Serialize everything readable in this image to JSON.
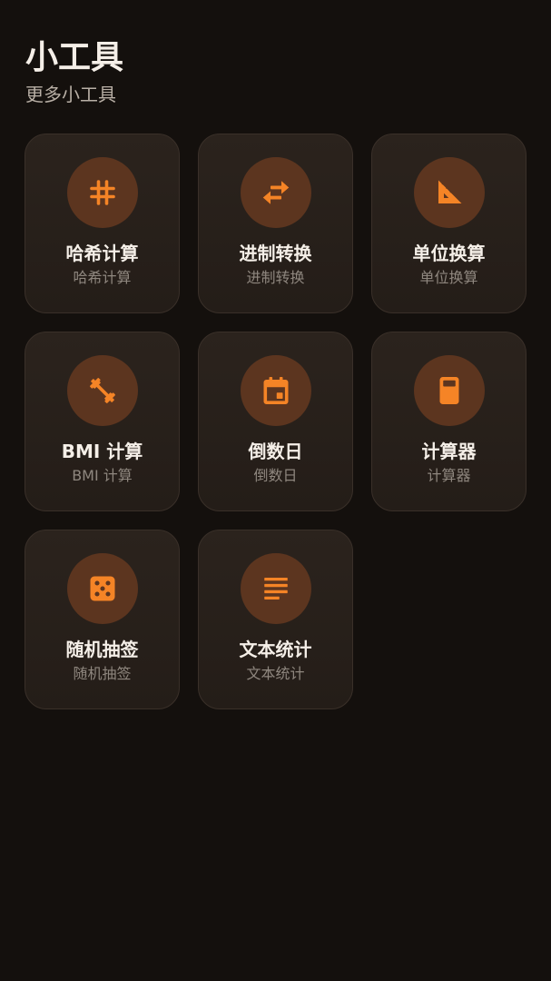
{
  "header": {
    "title": "小工具",
    "subtitle": "更多小工具"
  },
  "accent_color": "#f58426",
  "icon_bg_color": "#5c351f",
  "tools": [
    {
      "title": "哈希计算",
      "subtitle": "哈希计算",
      "icon": "hash-icon"
    },
    {
      "title": "进制转换",
      "subtitle": "进制转换",
      "icon": "swap-arrows-icon"
    },
    {
      "title": "单位换算",
      "subtitle": "单位换算",
      "icon": "set-square-ruler-icon"
    },
    {
      "title": "BMI 计算",
      "subtitle": "BMI 计算",
      "icon": "dumbbell-icon"
    },
    {
      "title": "倒数日",
      "subtitle": "倒数日",
      "icon": "calendar-icon"
    },
    {
      "title": "计算器",
      "subtitle": "计算器",
      "icon": "calculator-icon"
    },
    {
      "title": "随机抽签",
      "subtitle": "随机抽签",
      "icon": "dice-icon"
    },
    {
      "title": "文本统计",
      "subtitle": "文本统计",
      "icon": "text-lines-icon"
    }
  ]
}
